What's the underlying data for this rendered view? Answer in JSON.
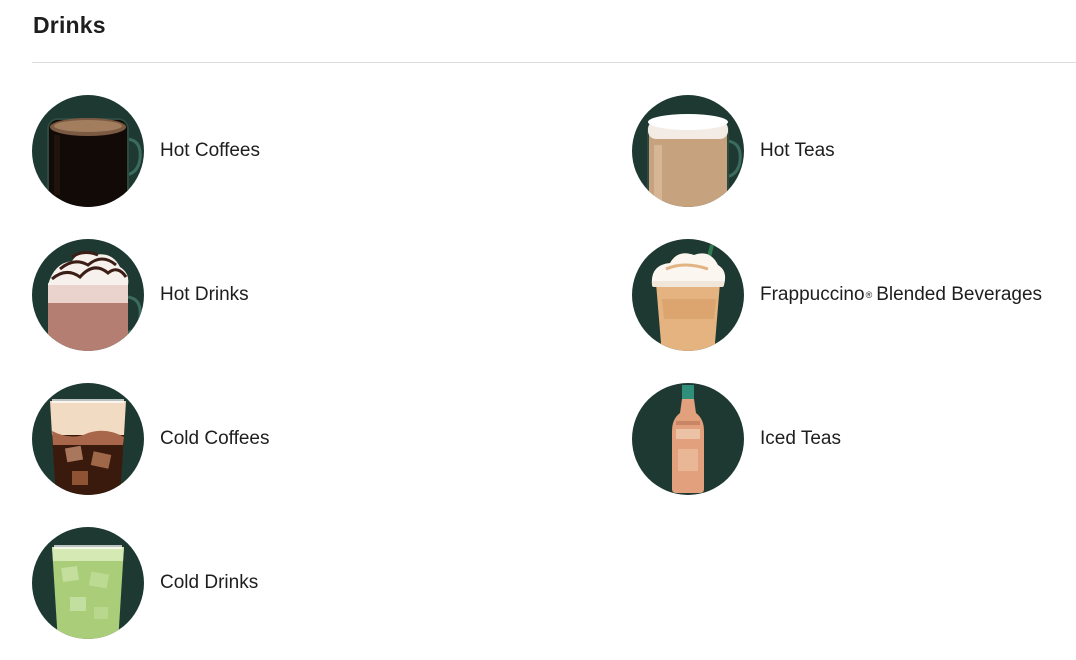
{
  "section": {
    "title": "Drinks"
  },
  "categories": [
    {
      "label": "Hot Coffees",
      "icon": "hot-coffee-mug-icon"
    },
    {
      "label": "Hot Teas",
      "icon": "hot-tea-latte-mug-icon"
    },
    {
      "label": "Hot Drinks",
      "icon": "hot-chocolate-whipped-cream-icon"
    },
    {
      "label": "Frappuccino",
      "label_suffix": "Blended Beverages",
      "registered_mark": "®",
      "icon": "frappuccino-cup-icon"
    },
    {
      "label": "Cold Coffees",
      "icon": "iced-coffee-glass-icon"
    },
    {
      "label": "Iced Teas",
      "icon": "iced-tea-bottle-icon"
    },
    {
      "label": "Cold Drinks",
      "icon": "iced-matcha-glass-icon"
    }
  ],
  "colors": {
    "thumb_background": "#1e3932",
    "divider": "#dcdcdc",
    "text": "#1e1e1e"
  }
}
